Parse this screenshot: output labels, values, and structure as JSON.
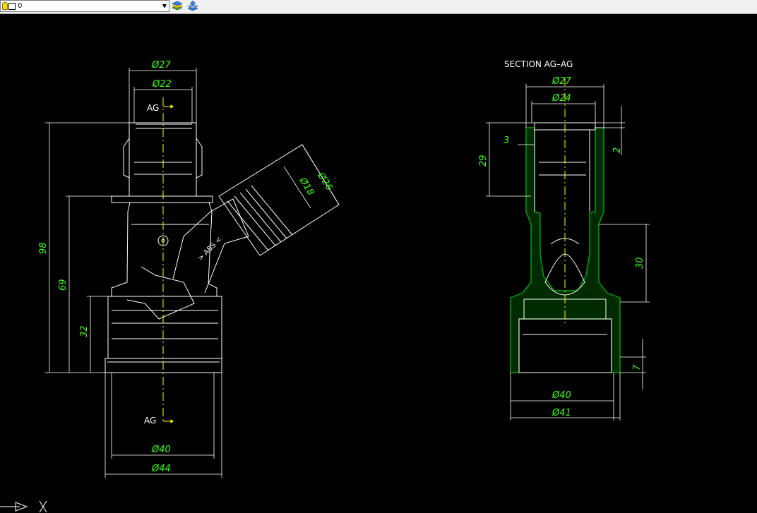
{
  "toolbar": {
    "layer_name": "0",
    "layer_dropdown_arrow": "▼",
    "icons": [
      "layer-states-icon",
      "layer-previous-icon"
    ]
  },
  "drawing": {
    "colors": {
      "background": "#000000",
      "geometry": "#ffffff",
      "dimension": "#39ff14",
      "section_label": "#ffffff",
      "centerline": "#ffff00",
      "hatch": "#00c000"
    },
    "front_view": {
      "dims": {
        "d27": "Ø27",
        "d22": "Ø22",
        "d26": "Ø26",
        "d18": "Ø18",
        "h98": "98",
        "h69": "69",
        "h32": "32",
        "d40": "Ø40",
        "d44": "Ø44"
      },
      "section_marks": {
        "top": "AG",
        "bottom": "AG"
      },
      "material": "> ABS <"
    },
    "section_view": {
      "title": "SECTION AG–AG",
      "dims": {
        "d27": "Ø27",
        "d24": "Ø24",
        "d3": "3",
        "d2": "2",
        "h29": "29",
        "h30": "30",
        "h7": "7",
        "d40": "Ø40",
        "d41": "Ø41"
      }
    }
  }
}
